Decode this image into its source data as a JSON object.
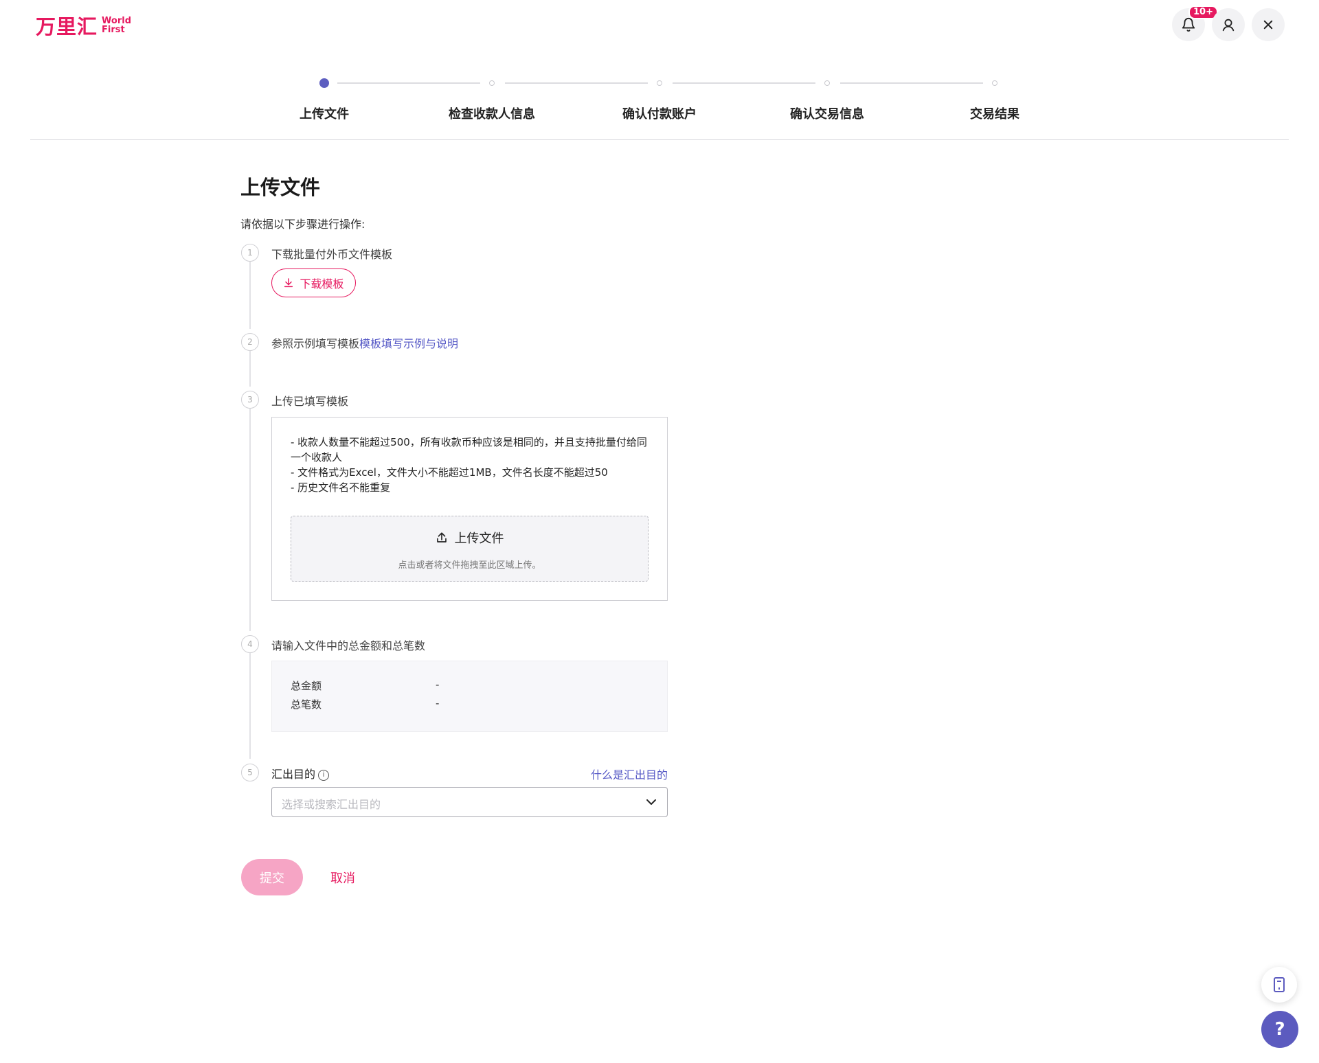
{
  "brand": {
    "name_cn": "万里汇",
    "name_en_1": "World",
    "name_en_2": "First"
  },
  "header": {
    "notification_badge": "10+",
    "bell_icon": "bell-icon",
    "user_icon": "user-icon",
    "close_icon": "close-icon"
  },
  "stepper": {
    "current_step": 1,
    "steps": [
      {
        "label": "上传文件"
      },
      {
        "label": "检查收款人信息"
      },
      {
        "label": "确认付款账户"
      },
      {
        "label": "确认交易信息"
      },
      {
        "label": "交易结果"
      }
    ]
  },
  "main": {
    "title": "上传文件",
    "intro": "请依据以下步骤进行操作:",
    "step1": {
      "num": "1",
      "label": "下载批量付外币文件模板",
      "button": "下载模板"
    },
    "step2": {
      "num": "2",
      "label": "参照示例填写模板",
      "link": "模板填写示例与说明"
    },
    "step3": {
      "num": "3",
      "label": "上传已填写模板",
      "rules": [
        "- 收款人数量不能超过500，所有收款币种应该是相同的，并且支持批量付给同一个收款人",
        "- 文件格式为Excel，文件大小不能超过1MB，文件名长度不能超过50",
        "- 历史文件名不能重复"
      ],
      "upload_title": "上传文件",
      "upload_hint": "点击或者将文件拖拽至此区域上传。"
    },
    "step4": {
      "num": "4",
      "label": "请输入文件中的总金额和总笔数",
      "total_amount_label": "总金额",
      "total_amount_value": "-",
      "total_count_label": "总笔数",
      "total_count_value": "-"
    },
    "step5": {
      "num": "5",
      "label": "汇出目的",
      "info": "i",
      "help_link": "什么是汇出目的",
      "select_placeholder": "选择或搜索汇出目的"
    },
    "actions": {
      "submit": "提交",
      "cancel": "取消"
    }
  },
  "floating": {
    "help": "?"
  },
  "colors": {
    "brand": "#e6195f",
    "accent": "#5d5ec0",
    "submit_disabled": "#f6a5c5"
  }
}
